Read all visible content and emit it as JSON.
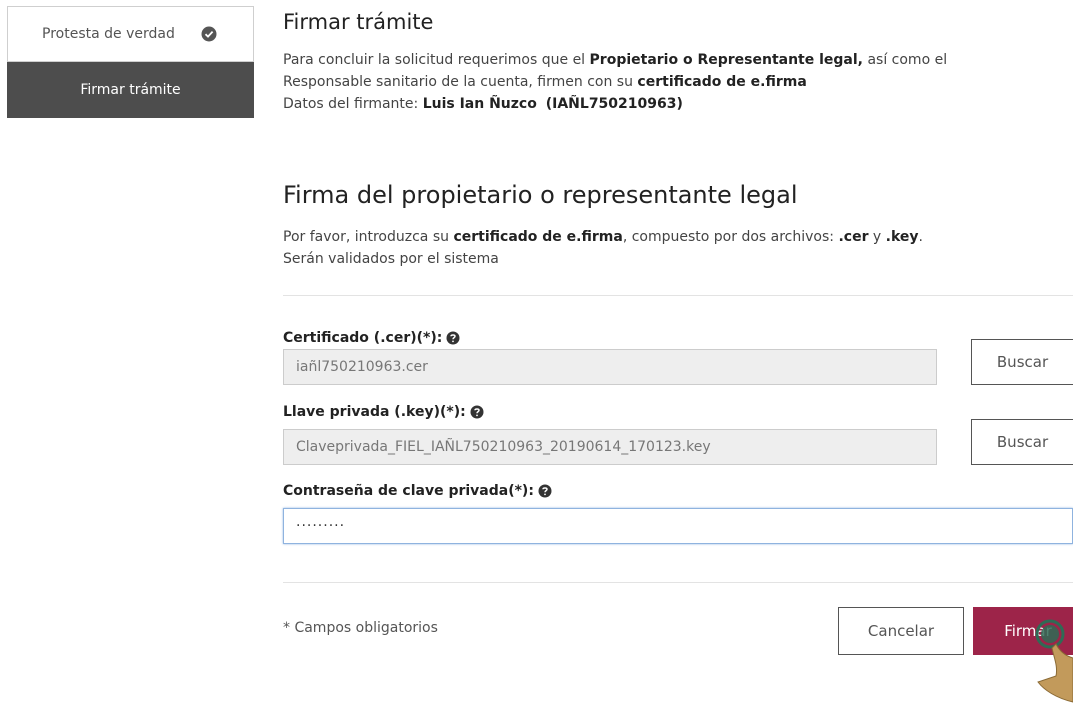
{
  "sidebar": {
    "steps": [
      {
        "label": "Protesta de verdad"
      },
      {
        "label": "Firmar trámite"
      }
    ]
  },
  "intro": {
    "title": "Firmar trámite",
    "line1_prefix": "Para concluir la solicitud requerimos que el ",
    "line1_bold": "Propietario o Representante legal,",
    "line1_suffix": " así como el",
    "line2_prefix": "Responsable sanitario de la cuenta, firmen con su ",
    "line2_bold": "certificado de e.firma",
    "line3_prefix": "Datos del firmante: ",
    "signer_name": "Luis Ian Ñuzco",
    "signer_rfc": "(IAÑL750210963)"
  },
  "section": {
    "title": "Firma del propietario o representante legal",
    "desc_prefix": "Por favor, introduzca su ",
    "desc_bold": "certificado de e.firma",
    "desc_middle": ", compuesto por dos archivos: ",
    "desc_cer": ".cer",
    "desc_y": " y ",
    "desc_key": ".key",
    "desc_end": ".",
    "desc_line2": "Serán validados por el sistema"
  },
  "form": {
    "cer_label": "Certificado (.cer)(*):",
    "cer_value": "iañl750210963.cer",
    "key_label": "Llave privada (.key)(*):",
    "key_value": "Claveprivada_FIEL_IAÑL750210963_20190614_170123.key",
    "pwd_label": "Contraseña de clave privada(*):",
    "pwd_value": "·········",
    "browse_label": "Buscar"
  },
  "footer": {
    "required_note": "* Campos obligatorios",
    "cancel_label": "Cancelar",
    "sign_label": "Firmar"
  },
  "colors": {
    "primary": "#9d2449",
    "active_step": "#4d4d4d"
  }
}
